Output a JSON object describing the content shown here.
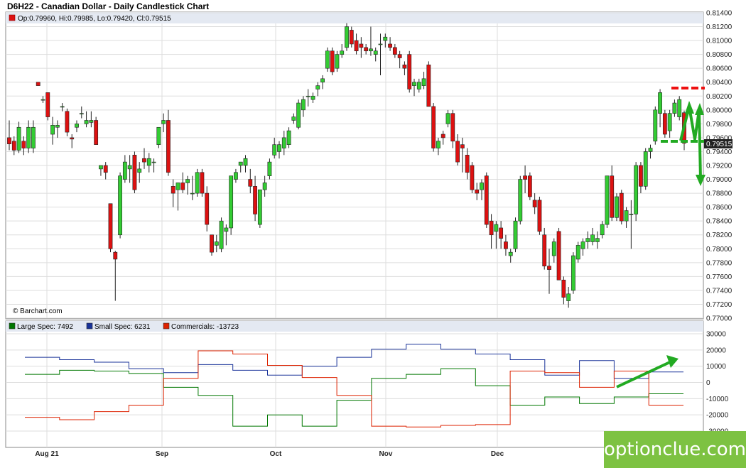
{
  "title": "D6H22 - Canadian Dollar - Daily Candlestick Chart",
  "ohlc_label": "Op:0.79960, Hi:0.79985, Lo:0.79420, Cl:0.79515",
  "price_marker": "0.79515",
  "credit": "© Barchart.com",
  "watermark": "optionclue.com",
  "colors": {
    "up": "#33cc33",
    "down": "#dd1111",
    "large": "#007700",
    "small": "#1a3399",
    "commercials": "#dd2200",
    "annotation": "#22aa22",
    "annotation_red": "#ee1111"
  },
  "chart_data": [
    {
      "type": "candlestick",
      "ylim": [
        0.77,
        0.814
      ],
      "y_ticks": [
        "0.81400",
        "0.81200",
        "0.81000",
        "0.80800",
        "0.80600",
        "0.80400",
        "0.80200",
        "0.80000",
        "0.79800",
        "0.79600",
        "0.79400",
        "0.79200",
        "0.79000",
        "0.78800",
        "0.78600",
        "0.78400",
        "0.78200",
        "0.78000",
        "0.77800",
        "0.77600",
        "0.77400",
        "0.77200",
        "0.77000"
      ],
      "x_ticks": [
        "Aug 21",
        "Sep",
        "Oct",
        "Nov",
        "Dec"
      ],
      "last_close": 0.79515,
      "candles": [
        [
          0.796,
          0.7985,
          0.7942,
          0.7951
        ],
        [
          0.7955,
          0.7962,
          0.7935,
          0.7942
        ],
        [
          0.7942,
          0.7983,
          0.7938,
          0.7975
        ],
        [
          0.7955,
          0.7962,
          0.7935,
          0.7945
        ],
        [
          0.7945,
          0.7985,
          0.7938,
          0.7975
        ],
        [
          0.7945,
          0.7985,
          0.7938,
          0.7975
        ],
        [
          0.804,
          0.804,
          0.8035,
          0.8035
        ],
        [
          0.8015,
          0.802,
          0.801,
          0.8015
        ],
        [
          0.8025,
          0.8025,
          0.7985,
          0.799
        ],
        [
          0.7965,
          0.799,
          0.795,
          0.7978
        ],
        [
          0.7975,
          0.7985,
          0.796,
          0.7978
        ],
        [
          0.8005,
          0.801,
          0.7998,
          0.8005
        ],
        [
          0.7998,
          0.8002,
          0.7962,
          0.7968
        ],
        [
          0.796,
          0.7965,
          0.7945,
          0.7958
        ],
        [
          0.7975,
          0.7985,
          0.7968,
          0.798
        ],
        [
          0.7995,
          0.8005,
          0.7988,
          0.7995
        ],
        [
          0.798,
          0.7998,
          0.7975,
          0.7985
        ],
        [
          0.7982,
          0.7998,
          0.7975,
          0.7985
        ],
        [
          0.7985,
          0.799,
          0.7955,
          0.795
        ],
        [
          0.7915,
          0.792,
          0.7905,
          0.792
        ],
        [
          0.792,
          0.7925,
          0.79,
          0.791
        ],
        [
          0.7865,
          0.7865,
          0.7795,
          0.78
        ],
        [
          0.7795,
          0.7797,
          0.7725,
          0.7785
        ],
        [
          0.782,
          0.791,
          0.7815,
          0.7905
        ],
        [
          0.79,
          0.7935,
          0.7895,
          0.7925
        ],
        [
          0.7915,
          0.7935,
          0.7895,
          0.792
        ],
        [
          0.7935,
          0.794,
          0.788,
          0.7885
        ],
        [
          0.791,
          0.7925,
          0.7895,
          0.7915
        ],
        [
          0.793,
          0.7945,
          0.7915,
          0.7925
        ],
        [
          0.792,
          0.7938,
          0.791,
          0.793
        ],
        [
          0.7925,
          0.793,
          0.791,
          0.7925
        ],
        [
          0.795,
          0.7975,
          0.7945,
          0.7975
        ],
        [
          0.798,
          0.7995,
          0.7968,
          0.7985
        ],
        [
          0.7985,
          0.8,
          0.7905,
          0.791
        ],
        [
          0.789,
          0.79,
          0.786,
          0.788
        ],
        [
          0.7885,
          0.7895,
          0.7855,
          0.7895
        ],
        [
          0.7895,
          0.791,
          0.788,
          0.7885
        ],
        [
          0.7895,
          0.7905,
          0.7878,
          0.79
        ],
        [
          0.788,
          0.7905,
          0.787,
          0.788
        ],
        [
          0.788,
          0.7915,
          0.7875,
          0.791
        ],
        [
          0.791,
          0.7915,
          0.7875,
          0.788
        ],
        [
          0.788,
          0.789,
          0.7825,
          0.7835
        ],
        [
          0.782,
          0.782,
          0.779,
          0.7795
        ],
        [
          0.7805,
          0.782,
          0.7795,
          0.781
        ],
        [
          0.78,
          0.7845,
          0.7795,
          0.784
        ],
        [
          0.7825,
          0.7835,
          0.7805,
          0.783
        ],
        [
          0.783,
          0.7905,
          0.782,
          0.7905
        ],
        [
          0.79,
          0.7915,
          0.7895,
          0.791
        ],
        [
          0.792,
          0.7925,
          0.791,
          0.7925
        ],
        [
          0.792,
          0.7935,
          0.791,
          0.793
        ],
        [
          0.79,
          0.7915,
          0.788,
          0.789
        ],
        [
          0.789,
          0.7905,
          0.784,
          0.785
        ],
        [
          0.7835,
          0.788,
          0.783,
          0.7885
        ],
        [
          0.7885,
          0.7905,
          0.7875,
          0.7895
        ],
        [
          0.7905,
          0.793,
          0.79,
          0.7925
        ],
        [
          0.7935,
          0.796,
          0.793,
          0.795
        ],
        [
          0.794,
          0.7955,
          0.793,
          0.795
        ],
        [
          0.7945,
          0.797,
          0.7935,
          0.796
        ],
        [
          0.795,
          0.7975,
          0.7945,
          0.797
        ],
        [
          0.7985,
          0.7995,
          0.798,
          0.799
        ],
        [
          0.7975,
          0.8015,
          0.7972,
          0.801
        ],
        [
          0.8,
          0.802,
          0.799,
          0.8015
        ],
        [
          0.802,
          0.803,
          0.8005,
          0.802
        ],
        [
          0.8015,
          0.8025,
          0.801,
          0.802
        ],
        [
          0.803,
          0.804,
          0.802,
          0.8035
        ],
        [
          0.804,
          0.805,
          0.803,
          0.8045
        ],
        [
          0.806,
          0.809,
          0.8055,
          0.8085
        ],
        [
          0.8085,
          0.809,
          0.805,
          0.8055
        ],
        [
          0.806,
          0.8085,
          0.8055,
          0.808
        ],
        [
          0.808,
          0.8095,
          0.8075,
          0.8085
        ],
        [
          0.809,
          0.8125,
          0.8085,
          0.812
        ],
        [
          0.8115,
          0.812,
          0.809,
          0.8095
        ],
        [
          0.81,
          0.811,
          0.808,
          0.8085
        ],
        [
          0.8095,
          0.8105,
          0.8075,
          0.809
        ],
        [
          0.809,
          0.8095,
          0.808,
          0.8085
        ],
        [
          0.8085,
          0.812,
          0.8078,
          0.8088
        ],
        [
          0.808,
          0.809,
          0.807,
          0.8085
        ],
        [
          0.8095,
          0.811,
          0.805,
          0.8095
        ],
        [
          0.81,
          0.811,
          0.809,
          0.8105
        ],
        [
          0.8095,
          0.8105,
          0.8085,
          0.809
        ],
        [
          0.809,
          0.8095,
          0.8075,
          0.808
        ],
        [
          0.808,
          0.8085,
          0.806,
          0.8075
        ],
        [
          0.8065,
          0.807,
          0.805,
          0.806
        ],
        [
          0.808,
          0.8085,
          0.8025,
          0.803
        ],
        [
          0.8035,
          0.8045,
          0.802,
          0.804
        ],
        [
          0.803,
          0.8045,
          0.8025,
          0.804
        ],
        [
          0.8035,
          0.8055,
          0.803,
          0.8045
        ],
        [
          0.8065,
          0.807,
          0.8005,
          0.8005
        ],
        [
          0.8005,
          0.801,
          0.794,
          0.7945
        ],
        [
          0.7945,
          0.796,
          0.7935,
          0.7955
        ],
        [
          0.7965,
          0.797,
          0.795,
          0.796
        ],
        [
          0.798,
          0.8,
          0.7975,
          0.7995
        ],
        [
          0.7995,
          0.8,
          0.7945,
          0.7955
        ],
        [
          0.7955,
          0.7965,
          0.792,
          0.7925
        ],
        [
          0.795,
          0.796,
          0.791,
          0.7945
        ],
        [
          0.7935,
          0.7945,
          0.79,
          0.791
        ],
        [
          0.792,
          0.7925,
          0.788,
          0.7885
        ],
        [
          0.7885,
          0.7895,
          0.787,
          0.788
        ],
        [
          0.7885,
          0.79,
          0.787,
          0.7895
        ],
        [
          0.7905,
          0.791,
          0.783,
          0.7835
        ],
        [
          0.784,
          0.785,
          0.78,
          0.782
        ],
        [
          0.7825,
          0.784,
          0.78,
          0.7835
        ],
        [
          0.783,
          0.784,
          0.78,
          0.7815
        ],
        [
          0.781,
          0.782,
          0.779,
          0.78
        ],
        [
          0.779,
          0.78,
          0.778,
          0.7795
        ],
        [
          0.78,
          0.7845,
          0.7795,
          0.784
        ],
        [
          0.784,
          0.7905,
          0.7835,
          0.79
        ],
        [
          0.7905,
          0.792,
          0.788,
          0.79
        ],
        [
          0.7905,
          0.791,
          0.787,
          0.7875
        ],
        [
          0.787,
          0.788,
          0.785,
          0.786
        ],
        [
          0.787,
          0.7875,
          0.782,
          0.7825
        ],
        [
          0.782,
          0.783,
          0.777,
          0.7775
        ],
        [
          0.7775,
          0.78,
          0.7735,
          0.777
        ],
        [
          0.779,
          0.7815,
          0.778,
          0.781
        ],
        [
          0.7825,
          0.783,
          0.776,
          0.7755
        ],
        [
          0.7755,
          0.776,
          0.772,
          0.773
        ],
        [
          0.7725,
          0.7745,
          0.7715,
          0.7735
        ],
        [
          0.774,
          0.7795,
          0.7735,
          0.779
        ],
        [
          0.7785,
          0.781,
          0.778,
          0.7805
        ],
        [
          0.78,
          0.7815,
          0.779,
          0.781
        ],
        [
          0.781,
          0.7825,
          0.78,
          0.7815
        ],
        [
          0.781,
          0.783,
          0.7805,
          0.782
        ],
        [
          0.781,
          0.7825,
          0.78,
          0.7815
        ],
        [
          0.782,
          0.784,
          0.7815,
          0.7835
        ],
        [
          0.7835,
          0.7905,
          0.783,
          0.7905
        ],
        [
          0.7905,
          0.792,
          0.784,
          0.7845
        ],
        [
          0.7845,
          0.788,
          0.784,
          0.7875
        ],
        [
          0.788,
          0.7885,
          0.7835,
          0.784
        ],
        [
          0.784,
          0.786,
          0.783,
          0.7855
        ],
        [
          0.785,
          0.787,
          0.78,
          0.785
        ],
        [
          0.785,
          0.7925,
          0.784,
          0.792
        ],
        [
          0.792,
          0.7925,
          0.788,
          0.789
        ],
        [
          0.789,
          0.7945,
          0.7885,
          0.794
        ],
        [
          0.794,
          0.795,
          0.793,
          0.7945
        ],
        [
          0.7955,
          0.8005,
          0.795,
          0.8
        ],
        [
          0.7995,
          0.803,
          0.7975,
          0.8025
        ],
        [
          0.7995,
          0.8,
          0.796,
          0.7965
        ],
        [
          0.797,
          0.8,
          0.796,
          0.7995
        ],
        [
          0.7995,
          0.8015,
          0.799,
          0.801
        ],
        [
          0.799,
          0.802,
          0.7985,
          0.8015
        ],
        [
          0.7996,
          0.7999,
          0.7942,
          0.7952
        ]
      ]
    },
    {
      "type": "line",
      "series": [
        {
          "name": "Large Spec: 7492",
          "color": "#007700"
        },
        {
          "name": "Small Spec: 6231",
          "color": "#1a3399"
        },
        {
          "name": "Commercials: -13723",
          "color": "#dd2200"
        }
      ],
      "ylim": [
        -30000,
        30000
      ],
      "y_ticks": [
        "30000",
        "20000",
        "10000",
        "0",
        "-10000",
        "-20000",
        "-30000"
      ],
      "x_ticks": [
        "Aug 21",
        "Sep",
        "Oct",
        "Nov",
        "Dec"
      ],
      "x": [
        0,
        1,
        2,
        3,
        4,
        5,
        6,
        7,
        8,
        9,
        10,
        11,
        12,
        13,
        14,
        15,
        16,
        17,
        18
      ],
      "large": [
        5000,
        7500,
        7000,
        5500,
        -3000,
        -8000,
        -27000,
        -20000,
        -27000,
        -11000,
        2500,
        5000,
        8500,
        -2000,
        -14000,
        -9000,
        -13000,
        -9000,
        -7000
      ],
      "small": [
        15500,
        14000,
        12500,
        8500,
        6000,
        11000,
        7500,
        4500,
        10000,
        15500,
        20500,
        23500,
        20500,
        17500,
        14000,
        4500,
        13500,
        2500,
        6500
      ],
      "commercials": [
        -21500,
        -23000,
        -18000,
        -14000,
        2500,
        19500,
        17500,
        10500,
        3000,
        -8000,
        -27000,
        -27500,
        -26500,
        -26000,
        7000,
        6000,
        -3000,
        7000,
        -14000
      ]
    }
  ]
}
